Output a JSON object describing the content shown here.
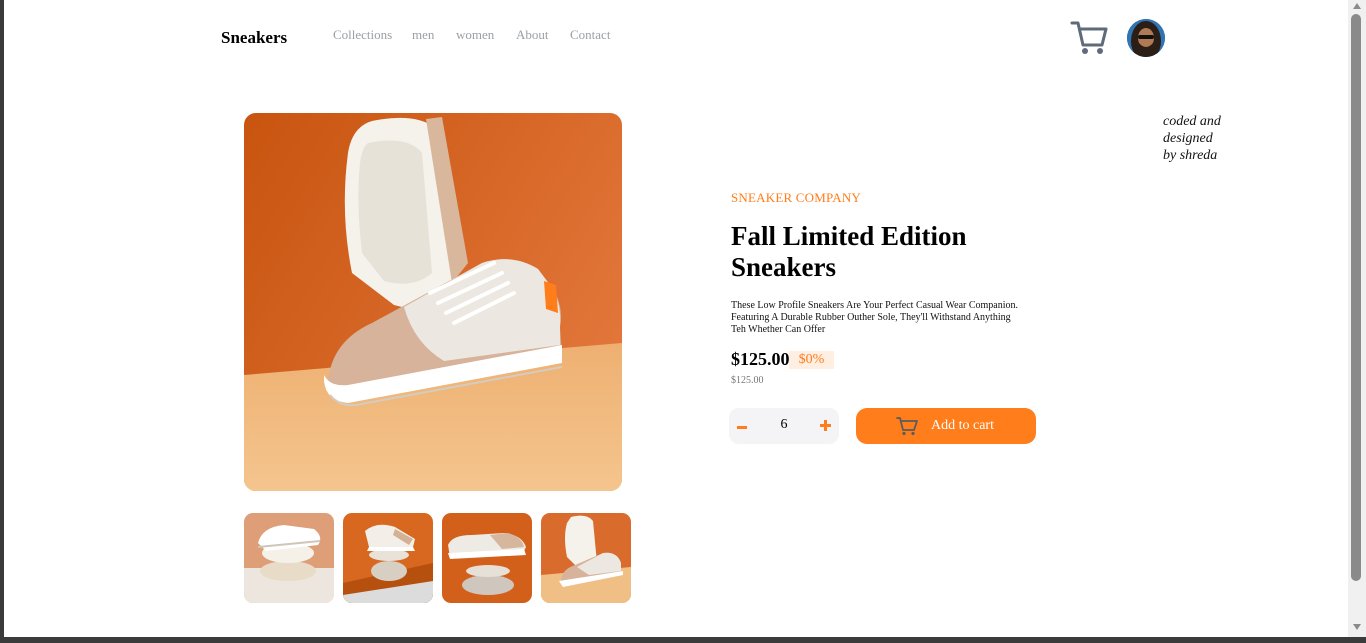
{
  "header": {
    "brand": "Sneakers",
    "nav": [
      "Collections",
      "men",
      "women",
      "About",
      "Contact"
    ],
    "cart_icon": "cart-icon",
    "avatar_icon": "avatar"
  },
  "credit": "coded and designed by shreda",
  "gallery": {
    "main_image": "sneaker-photo",
    "thumbnails": [
      "thumbnail-1",
      "thumbnail-2",
      "thumbnail-3",
      "thumbnail-4"
    ]
  },
  "product": {
    "company": "SNEAKER COMPANY",
    "title": "Fall Limited Edition Sneakers",
    "description": "These Low Profile Sneakers Are Your Perfect Casual Wear Companion. Featuring A Durable Rubber Outher Sole, They'll Withstand Anything Teh Whether Can Offer",
    "price": "$125.00",
    "discount": "$0%",
    "original_price": "$125.00",
    "quantity": "6",
    "add_to_cart": "Add to cart"
  },
  "colors": {
    "accent": "#ff7d1a",
    "accent_light": "#ffeee2",
    "nav_text": "#9aa0a6",
    "qty_bg": "#f4f4f6"
  }
}
